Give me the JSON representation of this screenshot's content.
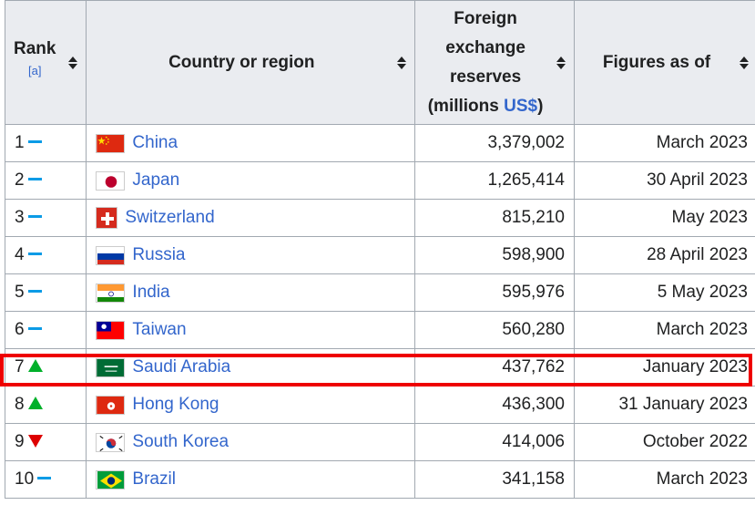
{
  "table": {
    "headers": {
      "rank": "Rank",
      "rank_ref": "[a]",
      "country": "Country or region",
      "reserves_line1": "Foreign",
      "reserves_line2": "exchange",
      "reserves_line3": "reserves",
      "reserves_line4_prefix": "(millions ",
      "reserves_line4_link": "US$",
      "reserves_line4_suffix": ")",
      "figures": "Figures as of"
    },
    "rows": [
      {
        "rank": "1",
        "change": "same",
        "country": "China",
        "flag": "china-flag-icon",
        "reserves": "3,379,002",
        "date": "March 2023"
      },
      {
        "rank": "2",
        "change": "same",
        "country": "Japan",
        "flag": "japan-flag-icon",
        "reserves": "1,265,414",
        "date": "30 April 2023"
      },
      {
        "rank": "3",
        "change": "same",
        "country": "Switzerland",
        "flag": "switzerland-flag-icon",
        "reserves": "815,210",
        "date": "May 2023"
      },
      {
        "rank": "4",
        "change": "same",
        "country": "Russia",
        "flag": "russia-flag-icon",
        "reserves": "598,900",
        "date": "28 April 2023"
      },
      {
        "rank": "5",
        "change": "same",
        "country": "India",
        "flag": "india-flag-icon",
        "reserves": "595,976",
        "date": "5 May 2023"
      },
      {
        "rank": "6",
        "change": "same",
        "country": "Taiwan",
        "flag": "taiwan-flag-icon",
        "reserves": "560,280",
        "date": "March 2023"
      },
      {
        "rank": "7",
        "change": "up",
        "country": "Saudi Arabia",
        "flag": "saudi-arabia-flag-icon",
        "reserves": "437,762",
        "date": "January 2023"
      },
      {
        "rank": "8",
        "change": "up",
        "country": "Hong Kong",
        "flag": "hong-kong-flag-icon",
        "reserves": "436,300",
        "date": "31 January 2023"
      },
      {
        "rank": "9",
        "change": "down",
        "country": "South Korea",
        "flag": "south-korea-flag-icon",
        "reserves": "414,006",
        "date": "October 2022"
      },
      {
        "rank": "10",
        "change": "same",
        "country": "Brazil",
        "flag": "brazil-flag-icon",
        "reserves": "341,158",
        "date": "March 2023"
      }
    ]
  },
  "colors": {
    "link": "#3366cc",
    "header_bg": "#eaecf0",
    "border": "#a2a9b1",
    "highlight": "#ee0000",
    "up": "#00b02a",
    "down": "#dd0000",
    "same": "#0b9be6"
  }
}
